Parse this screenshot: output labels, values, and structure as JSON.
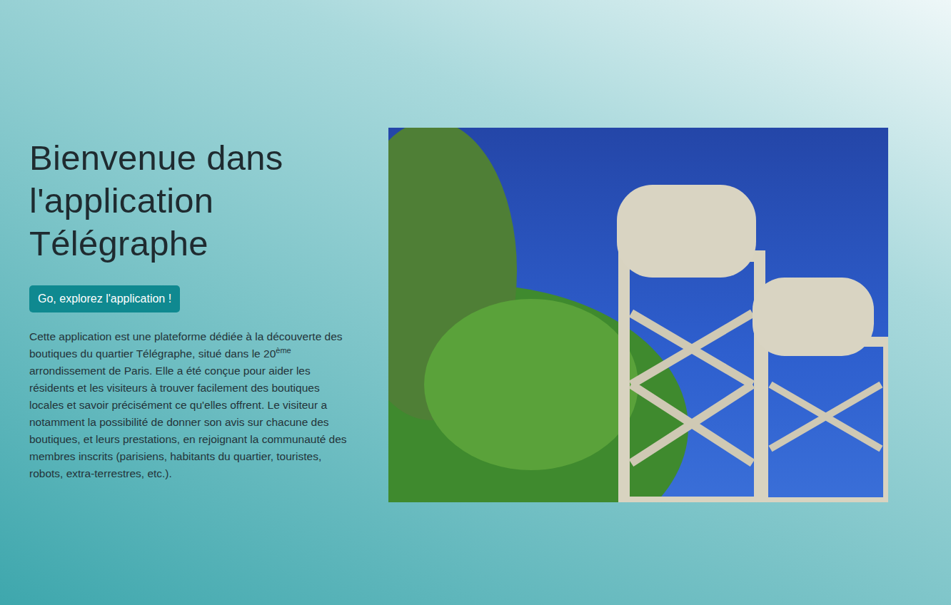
{
  "hero": {
    "title": "Bienvenue dans l'application Télégraphe",
    "button": "Go, explorez l'application !",
    "description": {
      "before": "Cette application est une plateforme dédiée à la découverte des boutiques du quartier Télégraphe, situé dans le 20",
      "sup": "ème",
      "after": " arrondissement de Paris. Elle a été conçue pour aider les résidents et les visiteurs à trouver facilement des boutiques locales et savoir précisément ce qu'elles offrent. Le visiteur a notamment la possibilité de donner son avis sur chacune des boutiques, et leurs prestations, en rejoignant la communauté des membres inscrits (parisiens, habitants du quartier, touristes, robots, extra-terrestres, etc.)."
    }
  }
}
